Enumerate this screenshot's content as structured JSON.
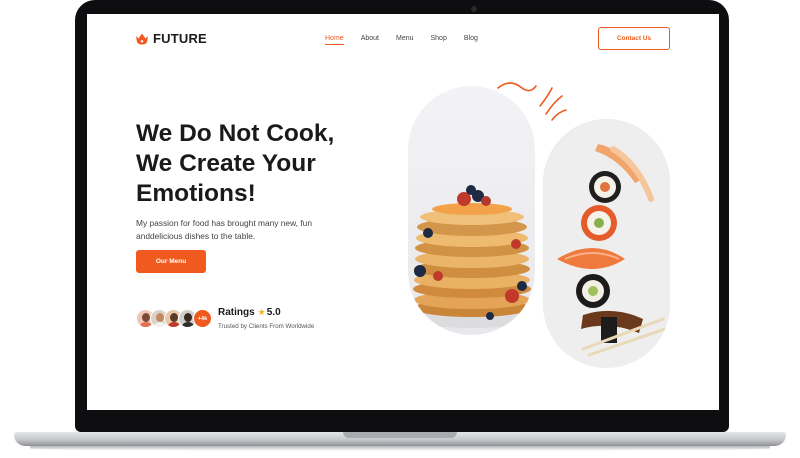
{
  "brand": {
    "name": "FUTURE",
    "icon": "flame-logo-icon",
    "color": "#f05a1f"
  },
  "nav": {
    "items": [
      {
        "label": "Home",
        "active": true
      },
      {
        "label": "About"
      },
      {
        "label": "Menu"
      },
      {
        "label": "Shop"
      },
      {
        "label": "Blog"
      }
    ],
    "contact_label": "Contact Us"
  },
  "hero": {
    "headline_lines": [
      "We Do Not Cook,",
      "We Create Your",
      "Emotions!"
    ],
    "sub_lines": [
      "My passion for food has brought many new, fun",
      "anddelicious dishes to the table."
    ],
    "cta_label": "Our Menu"
  },
  "ratings": {
    "avatar_count_label": "+4k",
    "label": "Ratings",
    "star_icon": "star-icon",
    "value": "5.0",
    "caption": "Trusted by Clients From Worldwide"
  },
  "images": {
    "left": "pancake-stack-image",
    "right": "sushi-rolls-image"
  },
  "colors": {
    "accent": "#f05a1f",
    "star": "#f5b623",
    "text": "#1a1a1a"
  }
}
